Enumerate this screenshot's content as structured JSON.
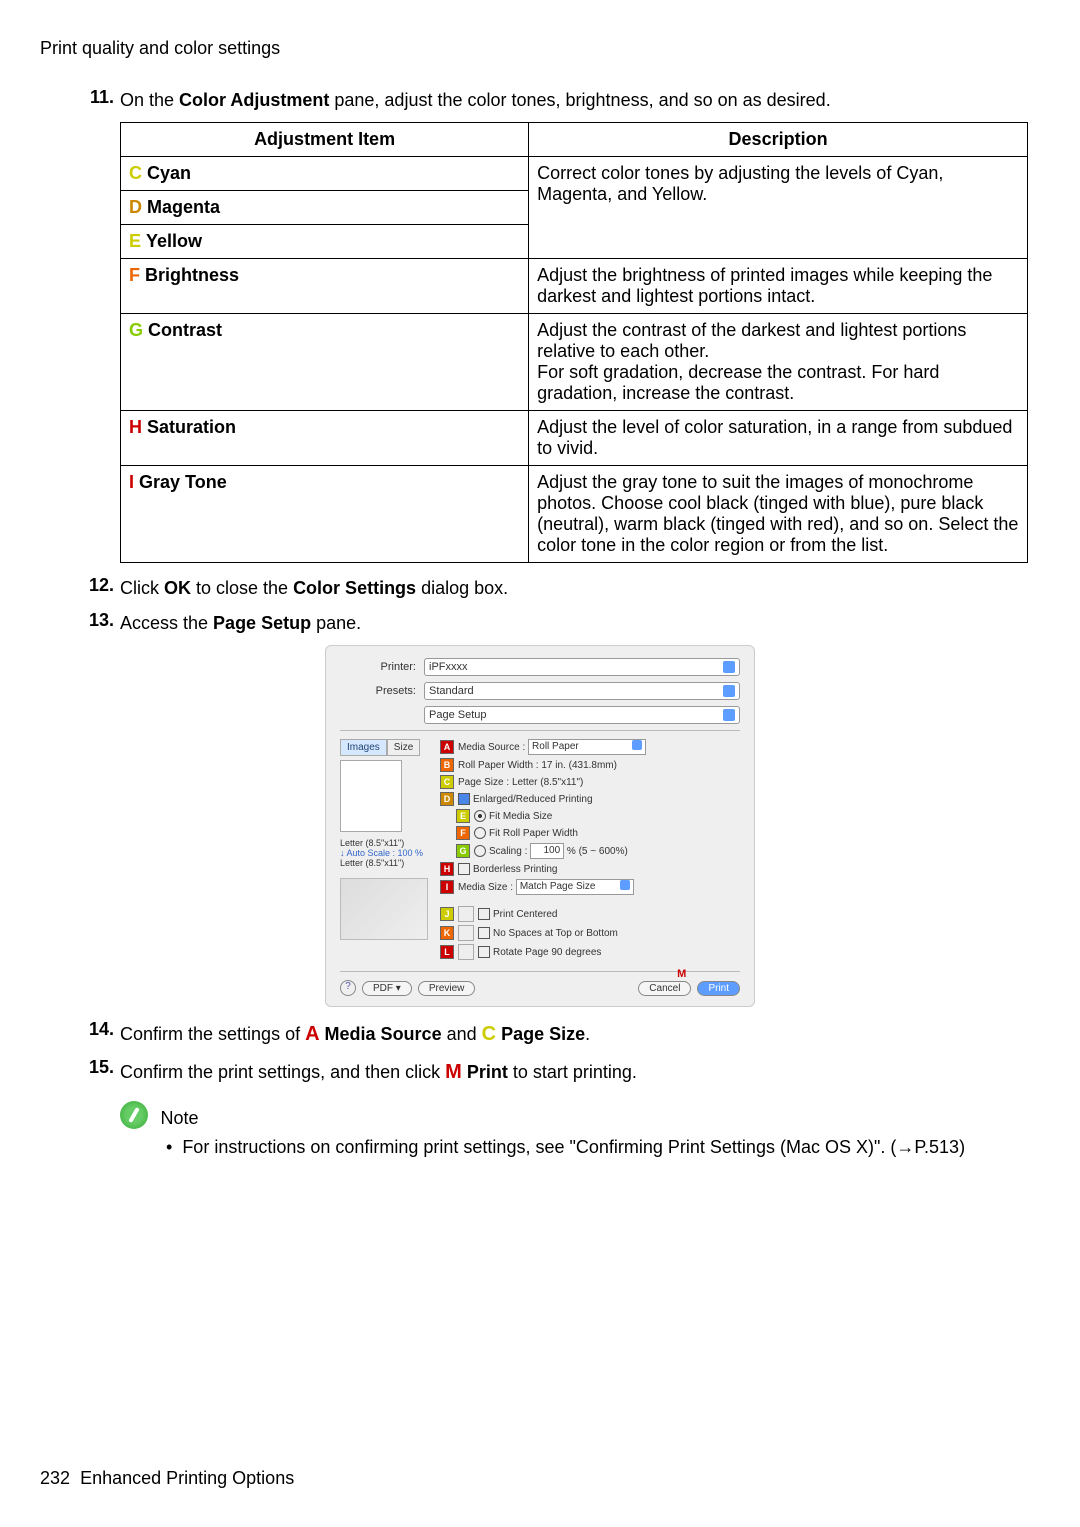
{
  "breadcrumb": "Print quality and color settings",
  "steps": {
    "s11": {
      "num": "11.",
      "pre": "On the ",
      "bold1": "Color Adjustment",
      "post": " pane, adjust the color tones, brightness, and so on as desired."
    },
    "s12": {
      "num": "12.",
      "pre": "Click ",
      "b1": "OK",
      "mid": " to close the ",
      "b2": "Color Settings",
      "post": " dialog box."
    },
    "s13": {
      "num": "13.",
      "pre": "Access the ",
      "b1": "Page Setup",
      "post": " pane."
    },
    "s14": {
      "num": "14.",
      "pre": "Confirm the settings of ",
      "la": "A",
      "b1": " Media Source",
      "mid": " and ",
      "lc": "C",
      "b2": " Page Size",
      "post": "."
    },
    "s15": {
      "num": "15.",
      "pre": "Confirm the print settings, and then click ",
      "lm": "M",
      "b1": " Print",
      "post": " to start printing."
    }
  },
  "table": {
    "h1": "Adjustment Item",
    "h2": "Description",
    "rows": [
      {
        "l": "C",
        "lc": "lbl-c",
        "name": "Cyan",
        "desc": ""
      },
      {
        "l": "D",
        "lc": "lbl-d",
        "name": "Magenta",
        "desc": ""
      },
      {
        "l": "E",
        "lc": "lbl-e",
        "name": "Yellow",
        "desc": ""
      }
    ],
    "cyanDesc": "Correct color tones by adjusting the levels of Cyan, Magenta, and Yellow.",
    "r4": {
      "l": "F",
      "lc": "lbl-f",
      "name": "Brightness",
      "desc": "Adjust the brightness of printed images while keeping the darkest and lightest portions intact."
    },
    "r5": {
      "l": "G",
      "lc": "lbl-g",
      "name": "Contrast",
      "desc": "Adjust the contrast of the darkest and lightest portions relative to each other.\nFor soft gradation, decrease the contrast. For hard gradation, increase the contrast."
    },
    "r6": {
      "l": "H",
      "lc": "lbl-h",
      "name": "Saturation",
      "desc": "Adjust the level of color saturation, in a range from subdued to vivid."
    },
    "r7": {
      "l": "I",
      "lc": "lbl-i",
      "name": "Gray Tone",
      "desc": "Adjust the gray tone to suit the images of monochrome photos. Choose cool black (tinged with blue), pure black (neutral), warm black (tinged with red), and so on. Select the color tone in the color region or from the list."
    }
  },
  "dialog": {
    "printerLabel": "Printer:",
    "printerValue": "iPFxxxx",
    "presetsLabel": "Presets:",
    "presetsValue": "Standard",
    "paneValue": "Page Setup",
    "tabs": {
      "images": "Images",
      "size": "Size"
    },
    "sideInfo1": "Letter (8.5\"x11\")",
    "sideInfo2": "Auto Scale : 100 %",
    "sideInfo3": "Letter (8.5\"x11\")",
    "items": {
      "a": {
        "l": "A",
        "label": "Media Source :",
        "value": "Roll Paper"
      },
      "b": {
        "l": "B",
        "label": "Roll Paper Width :",
        "value": "17 in. (431.8mm)"
      },
      "c": {
        "l": "C",
        "label": "Page Size :",
        "value": "Letter (8.5\"x11\")"
      },
      "d": {
        "l": "D",
        "label": "Enlarged/Reduced Printing"
      },
      "e": {
        "l": "E",
        "label": "Fit Media Size"
      },
      "f": {
        "l": "F",
        "label": "Fit Roll Paper Width"
      },
      "g": {
        "l": "G",
        "label": "Scaling :",
        "value": "100",
        "suffix": "% (5 ~ 600%)"
      },
      "h": {
        "l": "H",
        "label": "Borderless Printing"
      },
      "i": {
        "l": "I",
        "label": "Media Size :",
        "value": "Match Page Size"
      },
      "j": {
        "l": "J",
        "label": "Print Centered"
      },
      "k": {
        "l": "K",
        "label": "No Spaces at Top or Bottom"
      },
      "l": {
        "l": "L",
        "label": "Rotate Page 90 degrees"
      }
    },
    "mLabel": "M",
    "buttons": {
      "pdf": "PDF ▾",
      "preview": "Preview",
      "cancel": "Cancel",
      "print": "Print"
    }
  },
  "note": {
    "title": "Note",
    "item": "For instructions on confirming print settings, see \"Confirming Print Settings (Mac OS X)\". (→P.513)"
  },
  "footer": {
    "page": "232",
    "section": "Enhanced Printing Options"
  }
}
